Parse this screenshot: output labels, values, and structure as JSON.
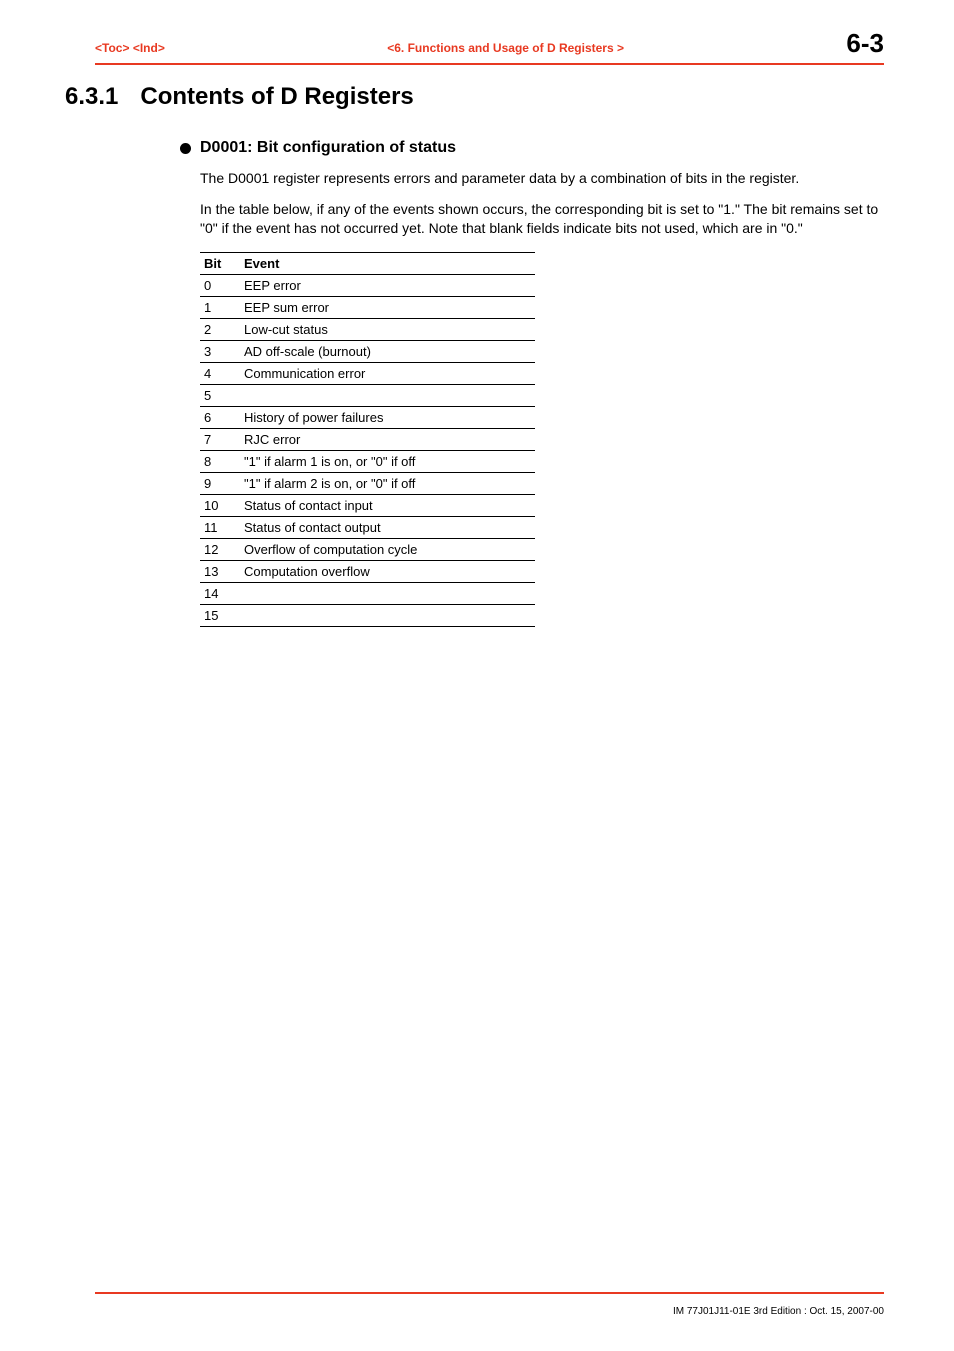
{
  "header": {
    "toc": "<Toc>",
    "ind": "<Ind>",
    "chapter": "<6.  Functions and Usage of D Registers >",
    "page": "6-3"
  },
  "section": {
    "number": "6.3.1",
    "title": "Contents of D Registers"
  },
  "subheading": "D0001: Bit configuration of status",
  "para1": "The D0001 register represents errors and parameter data by a combination of bits in the register.",
  "para2": "In the table below, if any of the events shown occurs, the corresponding bit is set to \"1.\" The bit remains set to \"0\" if the event has not occurred yet.  Note that blank fields indicate bits not used, which are in \"0.\"",
  "table": {
    "headers": {
      "bit": "Bit",
      "event": "Event"
    },
    "rows": [
      {
        "bit": "0",
        "event": "EEP error"
      },
      {
        "bit": "1",
        "event": "EEP sum error"
      },
      {
        "bit": "2",
        "event": "Low-cut status"
      },
      {
        "bit": "3",
        "event": "AD off-scale (burnout)"
      },
      {
        "bit": "4",
        "event": "Communication error"
      },
      {
        "bit": "5",
        "event": ""
      },
      {
        "bit": "6",
        "event": "History of power failures"
      },
      {
        "bit": "7",
        "event": "RJC error"
      },
      {
        "bit": "8",
        "event": "\"1\" if alarm 1 is on, or \"0\" if off"
      },
      {
        "bit": "9",
        "event": "\"1\" if alarm 2 is on, or \"0\" if off"
      },
      {
        "bit": "10",
        "event": "Status of contact input"
      },
      {
        "bit": "11",
        "event": "Status of contact output"
      },
      {
        "bit": "12",
        "event": "Overflow of computation cycle"
      },
      {
        "bit": "13",
        "event": "Computation overflow"
      },
      {
        "bit": "14",
        "event": ""
      },
      {
        "bit": "15",
        "event": ""
      }
    ]
  },
  "footer": "IM 77J01J11-01E    3rd Edition : Oct. 15, 2007-00"
}
